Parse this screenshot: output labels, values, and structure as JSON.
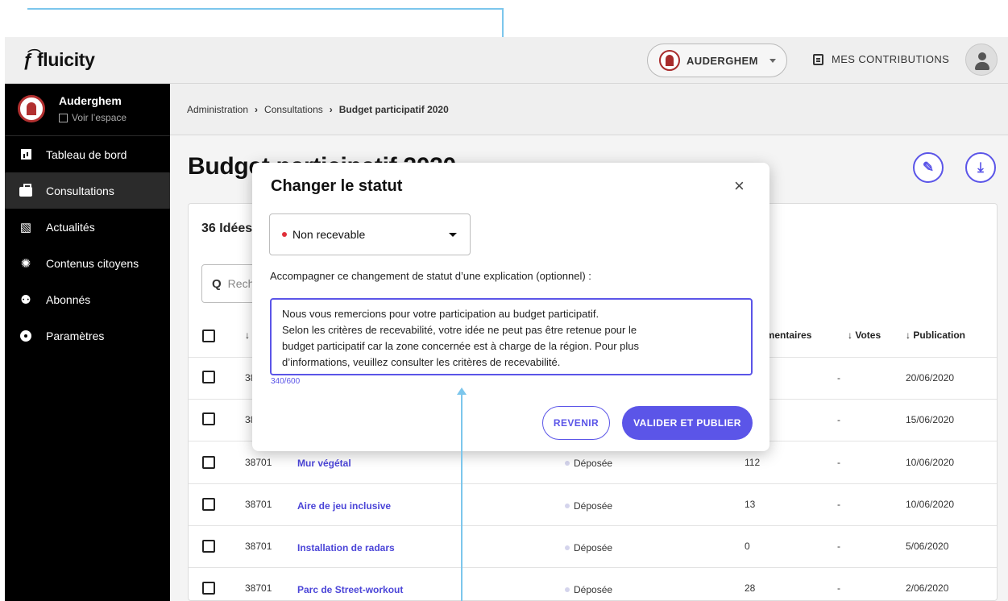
{
  "topbar": {
    "brand": "fluicity",
    "commune_label": "AUDERGHEM",
    "contributions_label": "MES CONTRIBUTIONS"
  },
  "sidebar": {
    "space_name": "Auderghem",
    "space_link": "Voir l’espace",
    "items": [
      {
        "label": "Tableau de bord",
        "icon": "dashboard-icon"
      },
      {
        "label": "Consultations",
        "icon": "briefcase-icon",
        "active": true
      },
      {
        "label": "Actualités",
        "icon": "news-icon"
      },
      {
        "label": "Contenus citoyens",
        "icon": "lightbulb-icon"
      },
      {
        "label": "Abonnés",
        "icon": "people-icon"
      },
      {
        "label": "Paramètres",
        "icon": "gear-icon"
      }
    ]
  },
  "breadcrumb": {
    "items": [
      "Administration",
      "Consultations",
      "Budget participatif 2020"
    ]
  },
  "page": {
    "title": "Budget participatif 2020",
    "ideas_count": "36 Idées",
    "search_placeholder": "Rechercher"
  },
  "table": {
    "headers": [
      "↓",
      "Commentaires",
      "↓ Votes",
      "↓ Publication"
    ],
    "rows": [
      {
        "id": "38701",
        "title": "",
        "status": "",
        "comments": "",
        "votes": "-",
        "date": "20/06/2020"
      },
      {
        "id": "38701",
        "title": "",
        "status": "",
        "comments": "",
        "votes": "-",
        "date": "15/06/2020"
      },
      {
        "id": "38701",
        "title": "Mur végétal",
        "status": "Déposée",
        "comments": "112",
        "votes": "-",
        "date": "10/06/2020"
      },
      {
        "id": "38701",
        "title": "Aire de jeu inclusive",
        "status": "Déposée",
        "comments": "13",
        "votes": "-",
        "date": "10/06/2020"
      },
      {
        "id": "38701",
        "title": "Installation de radars",
        "status": "Déposée",
        "comments": "0",
        "votes": "-",
        "date": "5/06/2020"
      },
      {
        "id": "38701",
        "title": "Parc de Street-workout",
        "status": "Déposée",
        "comments": "28",
        "votes": "-",
        "date": "2/06/2020"
      }
    ]
  },
  "modal": {
    "title": "Changer le statut",
    "close_glyph": "×",
    "selected_status": "Non recevable",
    "explain_label": "Accompagner ce changement de statut d’une explication (optionnel) :",
    "textarea_lines": [
      "Nous vous remercions pour votre participation au budget participatif.",
      "Selon les critères de recevabilité, votre idée ne peut pas être retenue pour le",
      "budget participatif car la zone concernée est à charge de la région. Pour plus",
      "d’informations, veuillez consulter les critères de recevabilité."
    ],
    "counter": "340/600",
    "back_label": "REVENIR",
    "validate_label": "VALIDER ET PUBLIER"
  },
  "colors": {
    "accent": "#5b55e8",
    "status_red": "#e0303a",
    "annotation": "#7cc6ec"
  }
}
